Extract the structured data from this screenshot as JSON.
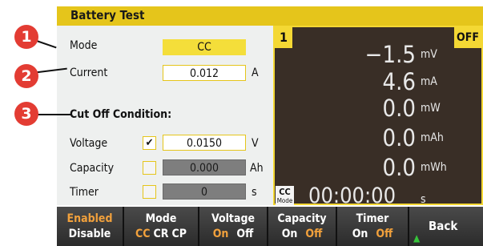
{
  "title": "Battery Test",
  "settings": {
    "mode": {
      "label": "Mode",
      "value": "CC"
    },
    "current": {
      "label": "Current",
      "value": "0.012",
      "unit": "A"
    },
    "cutoff_heading": "Cut Off Condition:",
    "voltage": {
      "label": "Voltage",
      "checked": true,
      "check_glyph": "✔",
      "value": "0.0150",
      "unit": "V"
    },
    "capacity": {
      "label": "Capacity",
      "checked": false,
      "check_glyph": "",
      "value": "0.000",
      "unit": "Ah"
    },
    "timer": {
      "label": "Timer",
      "checked": false,
      "check_glyph": "",
      "value": "0",
      "unit": "s"
    }
  },
  "callouts": [
    "1",
    "2",
    "3"
  ],
  "display": {
    "channel": "1",
    "output_state": "OFF",
    "readings": [
      {
        "value": "−1.5",
        "unit": "mV"
      },
      {
        "value": "4.6",
        "unit": "mA"
      },
      {
        "value": "0.0",
        "unit": "mW"
      },
      {
        "value": "0.0",
        "unit": "mAh"
      },
      {
        "value": "0.0",
        "unit": "mWh"
      }
    ],
    "mode_indicator": {
      "main": "CC",
      "sub": "Mode"
    },
    "timer": {
      "value": "00:00:00",
      "unit": "s"
    }
  },
  "softkeys": [
    {
      "top": "Enabled",
      "bottom": [
        "Disable"
      ],
      "active_top": true
    },
    {
      "top": "Mode",
      "bottom": [
        "CC",
        "CR",
        "CP"
      ],
      "active_index": 0
    },
    {
      "top": "Voltage",
      "bottom": [
        "On",
        "Off"
      ],
      "active_index": 0
    },
    {
      "top": "Capacity",
      "bottom": [
        "On",
        "Off"
      ],
      "active_index": 1
    },
    {
      "top": "Timer",
      "bottom": [
        "On",
        "Off"
      ],
      "active_index": 1
    }
  ],
  "back": {
    "label": "Back",
    "arrow_glyph": "▲"
  },
  "colors": {
    "accent_yellow": "#e5c51b",
    "highlight_yellow": "#f4de3a",
    "display_bg": "#392e26",
    "callout_red": "#e33c33",
    "softkey_active": "#f2a13c",
    "back_arrow": "#36c43a"
  }
}
